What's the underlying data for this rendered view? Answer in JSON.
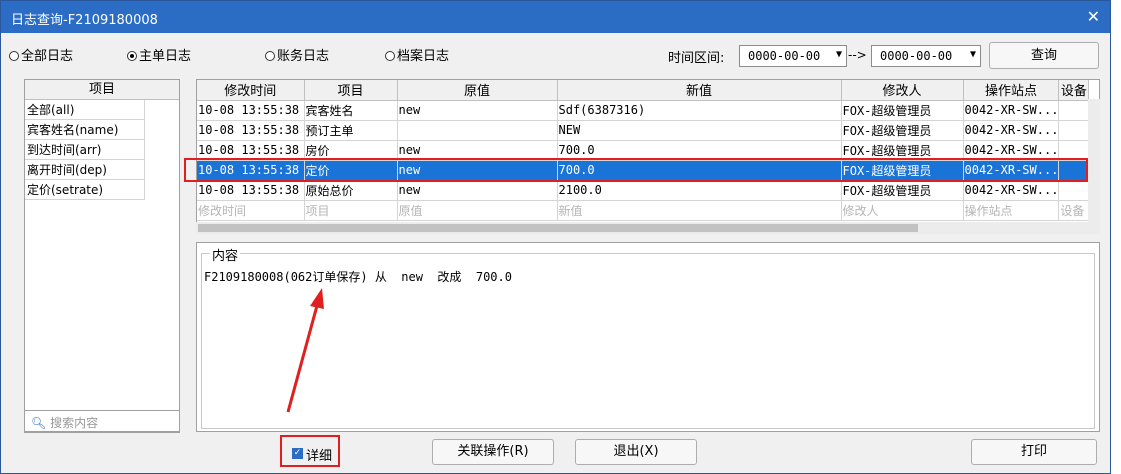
{
  "window": {
    "title": "日志查询-F2109180008",
    "close_glyph": "✕"
  },
  "filters": {
    "radios": [
      {
        "label": "全部日志",
        "checked": false
      },
      {
        "label": "主单日志",
        "checked": true
      },
      {
        "label": "账务日志",
        "checked": false
      },
      {
        "label": "档案日志",
        "checked": false
      }
    ],
    "time_label": "时间区间:",
    "date_from": "0000-00-00",
    "date_to": "0000-00-00",
    "range_arrow": "-->",
    "query_button": "查询"
  },
  "left_panel": {
    "header": "项目",
    "items": [
      "全部(all)",
      "宾客姓名(name)",
      "到达时间(arr)",
      "离开时间(dep)",
      "定价(setrate)"
    ],
    "search_placeholder": "搜索内容"
  },
  "grid": {
    "columns": [
      "修改时间",
      "项目",
      "原值",
      "新值",
      "修改人",
      "操作站点",
      "设备"
    ],
    "rows": [
      [
        "10-08 13:55:38",
        "宾客姓名",
        "new",
        "Sdf(6387316)",
        "FOX-超级管理员",
        "0042-XR-SW...",
        ""
      ],
      [
        "10-08 13:55:38",
        "预订主单",
        "",
        "NEW",
        "FOX-超级管理员",
        "0042-XR-SW...",
        ""
      ],
      [
        "10-08 13:55:38",
        "房价",
        "new",
        "700.0",
        "FOX-超级管理员",
        "0042-XR-SW...",
        ""
      ],
      [
        "10-08 13:55:38",
        "定价",
        "new",
        "700.0",
        "FOX-超级管理员",
        "0042-XR-SW...",
        ""
      ],
      [
        "10-08 13:55:38",
        "原始总价",
        "new",
        "2100.0",
        "FOX-超级管理员",
        "0042-XR-SW...",
        ""
      ]
    ],
    "selected_row": 3,
    "placeholder_row": [
      "修改时间",
      "项目",
      "原值",
      "新值",
      "修改人",
      "操作站点",
      "设备"
    ]
  },
  "content": {
    "legend": "内容",
    "text": "F2109180008(062订单保存) 从  new  改成  700.0"
  },
  "bottom": {
    "detail_checkbox_label": "详细",
    "detail_checked": true,
    "related_button": "关联操作(R)",
    "exit_button": "退出(X)",
    "print_button": "打印"
  },
  "colors": {
    "titlebar": "#2b6cc4",
    "selection": "#1a73d6",
    "highlight": "#e02020"
  }
}
